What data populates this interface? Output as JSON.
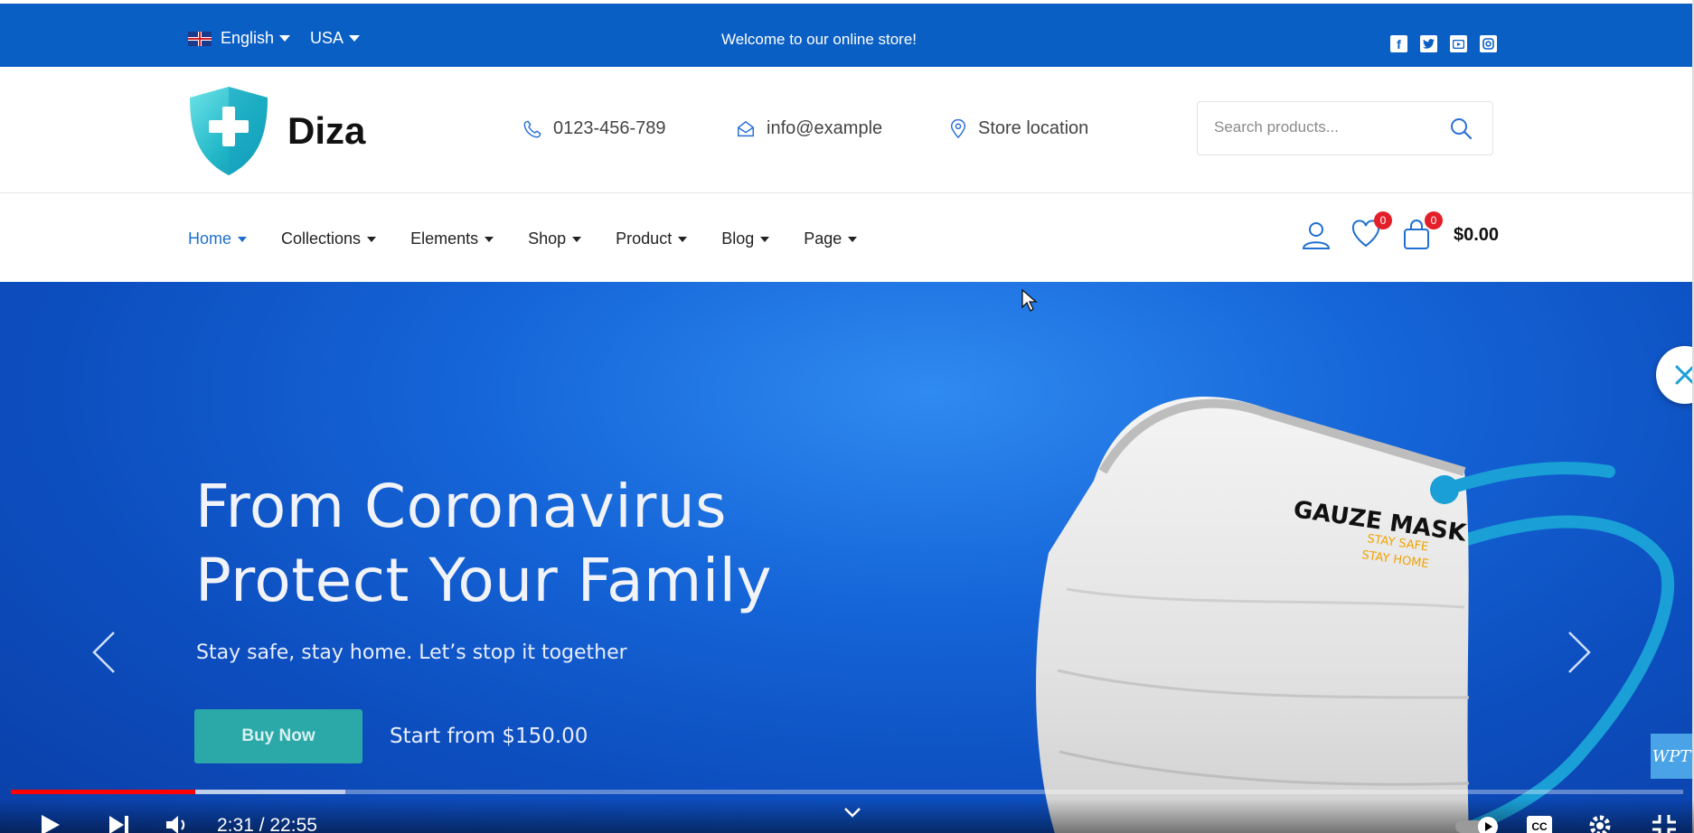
{
  "topbar": {
    "language": "English",
    "currency": "USA",
    "welcome": "Welcome to our online store!",
    "social_icons": [
      "facebook-icon",
      "twitter-icon",
      "youtube-icon",
      "instagram-icon"
    ]
  },
  "header": {
    "brand": "Diza",
    "phone": "0123-456-789",
    "email": "info@example",
    "location": "Store location",
    "search_placeholder": "Search products..."
  },
  "nav": {
    "items": [
      {
        "label": "Home",
        "active": true
      },
      {
        "label": "Collections"
      },
      {
        "label": "Elements"
      },
      {
        "label": "Shop"
      },
      {
        "label": "Product"
      },
      {
        "label": "Blog"
      },
      {
        "label": "Page"
      }
    ],
    "wishlist_count": "0",
    "cart_count": "0",
    "cart_total": "$0.00"
  },
  "hero": {
    "title_line1": "From Coronavirus",
    "title_line2": "Protect Your Family",
    "subtitle": "Stay safe, stay home. Let’s stop it together",
    "button": "Buy Now",
    "price_text": "Start from $150.00",
    "mask_label": "GAUZE MASK",
    "mask_tag1": "STAY SAFE",
    "mask_tag2": "STAY HOME"
  },
  "video": {
    "time": "2:31 / 22:55",
    "progress": 0.11,
    "buffered": 0.2,
    "watermark": "WPT"
  },
  "colors": {
    "topbar": "#0a5fc4",
    "accent_link": "#1f6fd0",
    "badge": "#e3202a",
    "buy_button": "#2ba8a8"
  }
}
